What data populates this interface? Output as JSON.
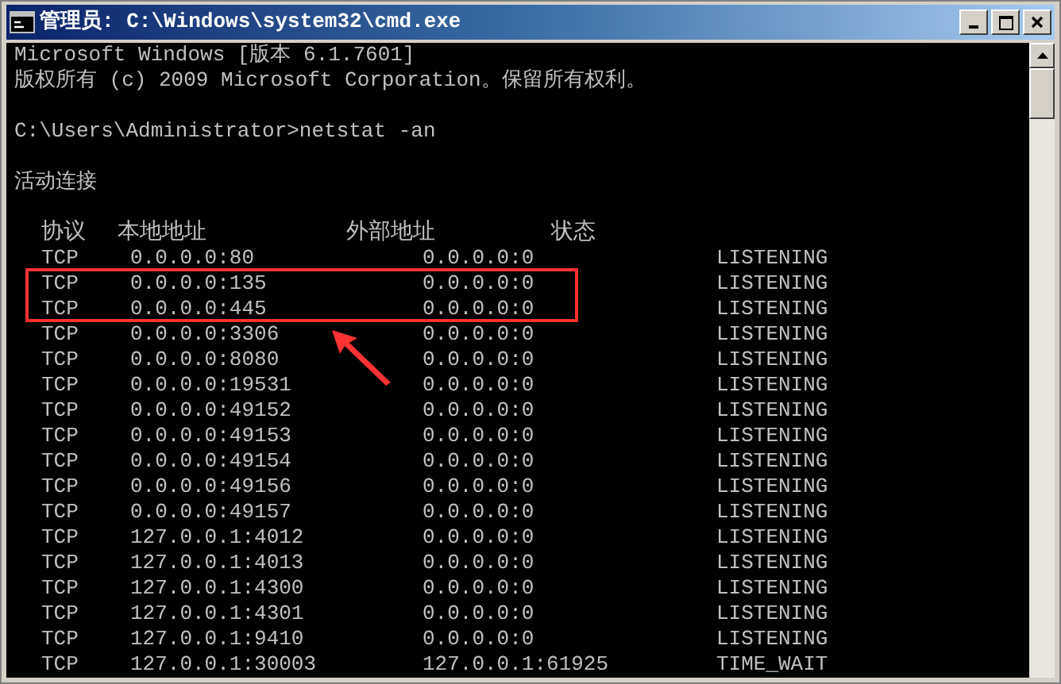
{
  "window": {
    "title": "管理员: C:\\Windows\\system32\\cmd.exe"
  },
  "console": {
    "paragraphs": [
      [
        "Microsoft Windows [版本 6.1.7601]",
        "版权所有 (c) 2009 Microsoft Corporation。保留所有权利。"
      ],
      [
        "C:\\Users\\Administrator>netstat -an"
      ],
      [
        "活动连接"
      ]
    ],
    "table": {
      "columns": [
        "协议",
        "本地地址",
        "外部地址",
        "状态"
      ],
      "rows": [
        {
          "protocol": "TCP",
          "local": "0.0.0.0:80",
          "foreign": "0.0.0.0:0",
          "state": "LISTENING",
          "highlighted": false
        },
        {
          "protocol": "TCP",
          "local": "0.0.0.0:135",
          "foreign": "0.0.0.0:0",
          "state": "LISTENING",
          "highlighted": true
        },
        {
          "protocol": "TCP",
          "local": "0.0.0.0:445",
          "foreign": "0.0.0.0:0",
          "state": "LISTENING",
          "highlighted": true
        },
        {
          "protocol": "TCP",
          "local": "0.0.0.0:3306",
          "foreign": "0.0.0.0:0",
          "state": "LISTENING",
          "highlighted": false
        },
        {
          "protocol": "TCP",
          "local": "0.0.0.0:8080",
          "foreign": "0.0.0.0:0",
          "state": "LISTENING",
          "highlighted": false
        },
        {
          "protocol": "TCP",
          "local": "0.0.0.0:19531",
          "foreign": "0.0.0.0:0",
          "state": "LISTENING",
          "highlighted": false
        },
        {
          "protocol": "TCP",
          "local": "0.0.0.0:49152",
          "foreign": "0.0.0.0:0",
          "state": "LISTENING",
          "highlighted": false
        },
        {
          "protocol": "TCP",
          "local": "0.0.0.0:49153",
          "foreign": "0.0.0.0:0",
          "state": "LISTENING",
          "highlighted": false
        },
        {
          "protocol": "TCP",
          "local": "0.0.0.0:49154",
          "foreign": "0.0.0.0:0",
          "state": "LISTENING",
          "highlighted": false
        },
        {
          "protocol": "TCP",
          "local": "0.0.0.0:49156",
          "foreign": "0.0.0.0:0",
          "state": "LISTENING",
          "highlighted": false
        },
        {
          "protocol": "TCP",
          "local": "0.0.0.0:49157",
          "foreign": "0.0.0.0:0",
          "state": "LISTENING",
          "highlighted": false
        },
        {
          "protocol": "TCP",
          "local": "127.0.0.1:4012",
          "foreign": "0.0.0.0:0",
          "state": "LISTENING",
          "highlighted": false
        },
        {
          "protocol": "TCP",
          "local": "127.0.0.1:4013",
          "foreign": "0.0.0.0:0",
          "state": "LISTENING",
          "highlighted": false
        },
        {
          "protocol": "TCP",
          "local": "127.0.0.1:4300",
          "foreign": "0.0.0.0:0",
          "state": "LISTENING",
          "highlighted": false
        },
        {
          "protocol": "TCP",
          "local": "127.0.0.1:4301",
          "foreign": "0.0.0.0:0",
          "state": "LISTENING",
          "highlighted": false
        },
        {
          "protocol": "TCP",
          "local": "127.0.0.1:9410",
          "foreign": "0.0.0.0:0",
          "state": "LISTENING",
          "highlighted": false
        },
        {
          "protocol": "TCP",
          "local": "127.0.0.1:30003",
          "foreign": "127.0.0.1:61925",
          "state": "TIME_WAIT",
          "highlighted": false
        }
      ]
    }
  }
}
